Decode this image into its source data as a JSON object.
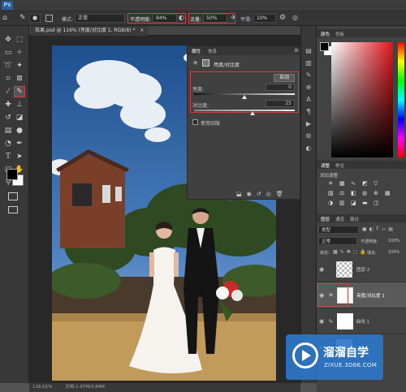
{
  "menubar": {
    "logo": "Ps"
  },
  "options": {
    "mode_label": "模式:",
    "mode_value": "正常",
    "opacity_label": "不透明度:",
    "opacity_value": "94%",
    "flow_label": "流量:",
    "flow_value": "50%",
    "smooth_label": "平滑:",
    "smooth_value": "10%"
  },
  "document": {
    "tab_title": "效果.psd @ 116% (亮度/对比度 1, RGB/8) *",
    "zoom": "116.01%",
    "doc_info": "文档:1.07M/3.84M"
  },
  "properties": {
    "tab_properties": "属性",
    "tab_info": "信息",
    "adjustment_title": "亮度/对比度",
    "auto_button": "自动",
    "brightness_label": "亮度:",
    "brightness_value": "0",
    "brightness_level": 0.5,
    "contrast_label": "对比度:",
    "contrast_value": "25",
    "contrast_level": 0.58,
    "legacy_label": "使用旧版"
  },
  "color_panel": {
    "tab_color": "颜色",
    "tab_swatches": "色板"
  },
  "adjust_panel": {
    "tab_adjust": "调整",
    "tab_styles": "样式",
    "add_label": "添加调整"
  },
  "layers_panel": {
    "tab_layers": "图层",
    "tab_channels": "通道",
    "tab_paths": "路径",
    "kind_value": "类型",
    "blend_value": "正常",
    "opacity_label": "不透明度:",
    "opacity_value": "100%",
    "lock_label": "锁定:",
    "fill_label": "填充:",
    "fill_value": "100%",
    "layers": [
      {
        "name": "图层 2"
      },
      {
        "name": "亮度/对比度 1"
      },
      {
        "name": "曲线 1"
      }
    ]
  },
  "watermark": {
    "name": "溜溜自学",
    "url": "ZIXUE.3D66.COM"
  },
  "colors": {
    "accent_red": "#d24040",
    "foreground": "#000000",
    "background": "#ffffff"
  }
}
